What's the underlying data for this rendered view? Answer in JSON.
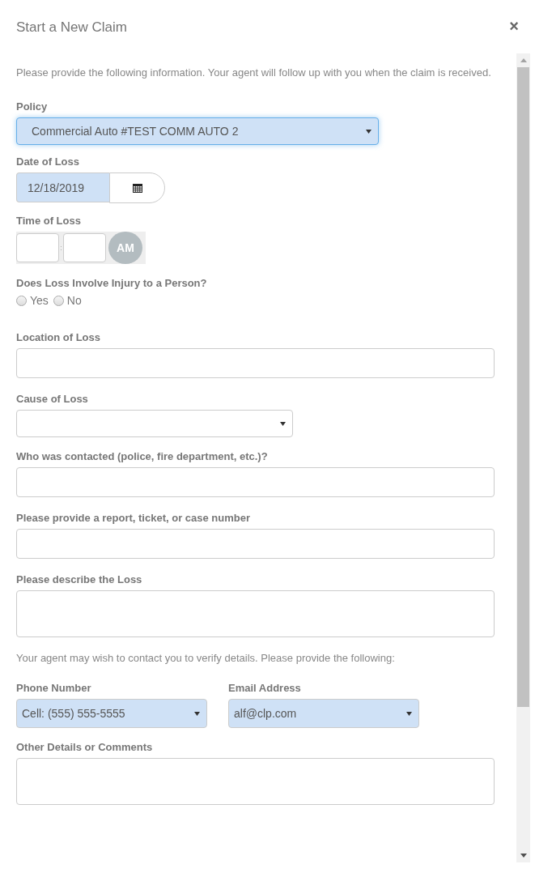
{
  "dialog": {
    "title": "Start a New Claim",
    "close": "×"
  },
  "intro": "Please provide the following information. Your agent will follow up with you when the claim is received.",
  "fields": [
    {
      "kind": "select",
      "label": "Policy",
      "value": "Commercial Auto #TEST COMM AUTO 2",
      "filled": true,
      "focused": true,
      "wide": true
    },
    {
      "kind": "date",
      "label": "Date of Loss",
      "value": "12/18/2019",
      "filled": true
    },
    {
      "kind": "time",
      "label": "Time of Loss",
      "separator": ":",
      "meridiem": "AM"
    },
    {
      "kind": "radio",
      "label": "Does Loss Involve Injury to a Person?",
      "options": [
        {
          "label": "Yes",
          "selected": false
        },
        {
          "label": "No",
          "selected": false
        }
      ]
    },
    {
      "kind": "text",
      "label": "Location of Loss"
    },
    {
      "kind": "select",
      "label": "Cause of Loss",
      "filled": false,
      "focused": false,
      "wide": false
    },
    {
      "kind": "text",
      "label": "Who was contacted (police, fire department, etc.)?"
    },
    {
      "kind": "text",
      "label": "Please provide a report, ticket, or case number"
    },
    {
      "kind": "textarea",
      "label": "Please describe the Loss"
    },
    {
      "kind": "note",
      "text": "Your agent may wish to contact you to verify details. Please provide the following:"
    },
    {
      "kind": "pair",
      "items": [
        {
          "label": "Phone Number",
          "value": "Cell: (555) 555-5555",
          "filled": true
        },
        {
          "label": "Email Address",
          "value": "alf@clp.com",
          "filled": true
        }
      ]
    },
    {
      "kind": "textarea",
      "label": "Other Details or Comments"
    }
  ]
}
